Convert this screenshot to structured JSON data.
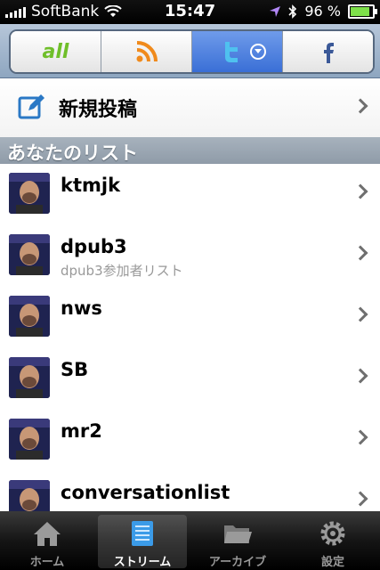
{
  "status_bar": {
    "carrier": "SoftBank",
    "time": "15:47",
    "battery": "96 %",
    "battery_level": 0.96
  },
  "segments": [
    {
      "id": "all",
      "label": "all",
      "icon": "all-icon"
    },
    {
      "id": "rss",
      "icon": "rss-icon"
    },
    {
      "id": "twitter",
      "icon": "twitter-icon",
      "active": true
    },
    {
      "id": "facebook",
      "icon": "facebook-icon"
    }
  ],
  "new_post": {
    "label": "新規投稿",
    "icon": "compose-icon"
  },
  "section": {
    "title": "あなたのリスト"
  },
  "lists": [
    {
      "name": "ktmjk",
      "description": ""
    },
    {
      "name": "dpub3",
      "description": "dpub3参加者リスト"
    },
    {
      "name": "nws",
      "description": ""
    },
    {
      "name": "SB",
      "description": ""
    },
    {
      "name": "mr2",
      "description": ""
    },
    {
      "name": "conversationlist",
      "description": ""
    }
  ],
  "tabs": [
    {
      "label": "ホーム",
      "icon": "home-icon"
    },
    {
      "label": "ストリーム",
      "icon": "stream-icon",
      "active": true
    },
    {
      "label": "アーカイブ",
      "icon": "folder-icon"
    },
    {
      "label": "設定",
      "icon": "gear-icon"
    }
  ],
  "colors": {
    "accent": "#3a6fd6",
    "all_green": "#6fbf2a",
    "rss_orange": "#f08a1c",
    "twitter_blue": "#4fc1ef",
    "facebook_blue": "#3b5998"
  }
}
